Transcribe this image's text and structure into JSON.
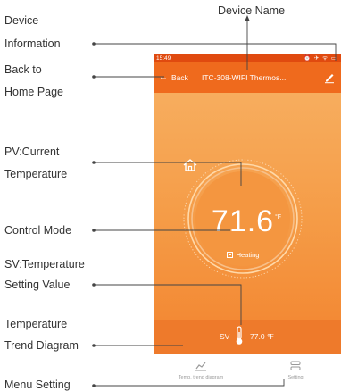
{
  "callouts": {
    "device_info_line1": "Device",
    "device_info_line2": "Information",
    "device_name": "Device Name",
    "back_line1": "Back to",
    "back_line2": "Home Page",
    "pv_line1": "PV:Current",
    "pv_line2": "Temperature",
    "control_mode": "Control Mode",
    "sv_line1": "SV:Temperature",
    "sv_line2": "Setting Value",
    "trend_line1": "Temperature",
    "trend_line2": "Trend Diagram",
    "menu_setting": "Menu Setting"
  },
  "phone": {
    "status_time": "15:49",
    "status_icons": "⏰ ✈ ᯤ ▭",
    "back_label": "Back",
    "device_name": "ITC-308-WIFI Thermos...",
    "current_temp": "71.6",
    "temp_unit": "°F",
    "mode_label": "Heating",
    "sv_label": "SV",
    "sv_value": "77.0 ℉",
    "tab_trend_label": "Temp. trend diagram",
    "tab_setting_label": "Setting"
  },
  "colors": {
    "status_bar": "#e04a0f",
    "app_bar": "#ef6a1d",
    "gradient_top": "#f7ad5e",
    "gradient_bottom": "#f38a35",
    "sv_bar": "#ee7a2b"
  },
  "icons": [
    "back-arrow-icon",
    "edit-icon",
    "home-icon",
    "heating-icon",
    "thermometer-icon",
    "trend-chart-icon",
    "setting-menu-icon"
  ]
}
